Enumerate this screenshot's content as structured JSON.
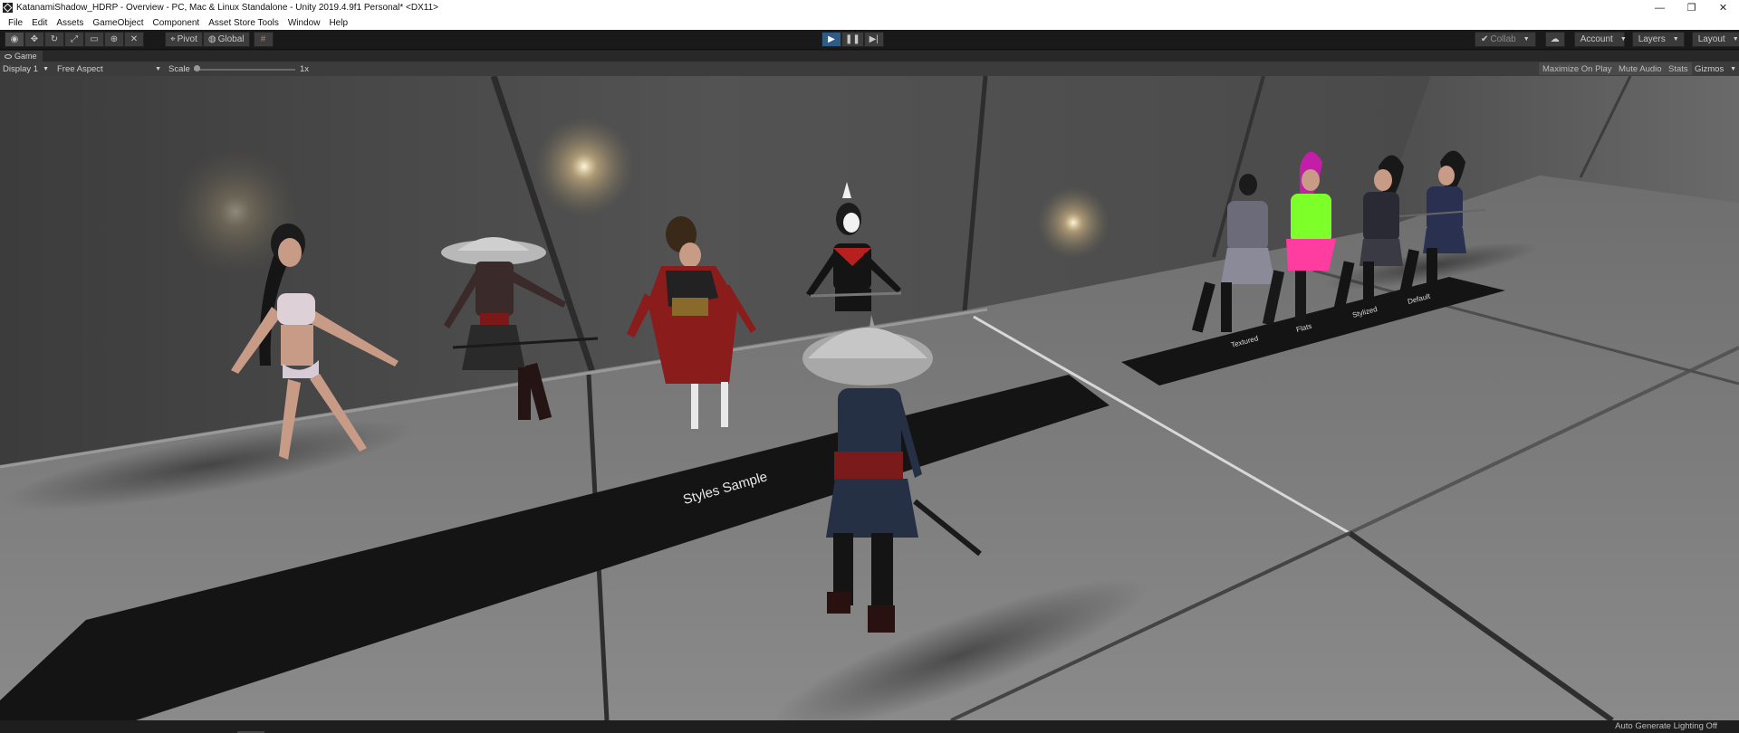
{
  "window": {
    "title": "KatanamiShadow_HDRP - Overview - PC, Mac & Linux Standalone - Unity 2019.4.9f1 Personal* <DX11>",
    "controls": [
      "—",
      "❐",
      "✕"
    ]
  },
  "menu": [
    "File",
    "Edit",
    "Assets",
    "GameObject",
    "Component",
    "Asset Store Tools",
    "Window",
    "Help"
  ],
  "toolbar": {
    "tools": [
      "view-tool-icon",
      "move-tool-icon",
      "rotate-tool-icon",
      "scale-tool-icon",
      "rect-tool-icon",
      "transform-tool-icon",
      "custom-tool-icon"
    ],
    "pivot_label": "Pivot",
    "global_label": "Global",
    "play_state": "playing",
    "collab_label": "Collab",
    "account_label": "Account",
    "layers_label": "Layers",
    "layout_label": "Layout"
  },
  "game_tab": {
    "label": "Game"
  },
  "game_view": {
    "display_label": "Display 1",
    "aspect_label": "Free Aspect",
    "scale_label": "Scale",
    "scale_value": "1x",
    "toggles": [
      "Maximize On Play",
      "Mute Audio",
      "Stats",
      "Gizmos"
    ]
  },
  "scene": {
    "banner_text": "Styles Sample",
    "far_banner_labels": [
      "Textured",
      "Flats",
      "Stylized",
      "Default"
    ]
  },
  "status": {
    "text": "Auto Generate Lighting Off"
  },
  "colors": {
    "play_active": "#2f5b87",
    "toolbar_bg": "#191919",
    "gamebar_bg": "#3c3c3c"
  }
}
